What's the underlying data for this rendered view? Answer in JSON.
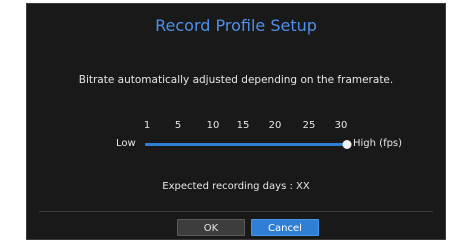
{
  "dialog": {
    "title": "Record Profile Setup",
    "subtitle": "Bitrate automatically adjusted depending on the framerate.",
    "slider": {
      "ticks": [
        "1",
        "5",
        "10",
        "15",
        "20",
        "25",
        "30"
      ],
      "low_label": "Low",
      "high_label": "High (fps)",
      "value": "30"
    },
    "expected_days": "Expected recording days : XX",
    "buttons": {
      "ok": "OK",
      "cancel": "Cancel"
    }
  },
  "colors": {
    "title": "#4f8fe8",
    "accent": "#2f7fd6",
    "dialog_bg": "#191919"
  }
}
